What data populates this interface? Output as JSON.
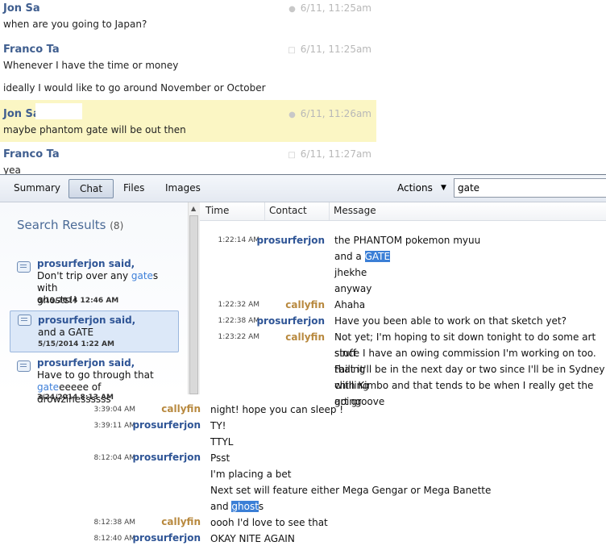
{
  "top_chat": [
    {
      "name": "Jon Sa",
      "meta": "6/11, 11:25am",
      "icon": "pin-icon",
      "lines": [
        "when are you going to Japan?"
      ]
    },
    {
      "name": "Franco Ta",
      "meta": "6/11, 11:25am",
      "icon": "comment-icon",
      "lines": [
        "Whenever I have the time or money",
        "ideally I would like to go around November or October"
      ]
    },
    {
      "name": "Jon Sa",
      "meta": "6/11, 11:26am",
      "icon": "pin-icon",
      "lines": [
        "maybe phantom gate will be out then"
      ]
    },
    {
      "name": "Franco Ta",
      "meta": "6/11, 11:27am",
      "icon": "comment-icon",
      "lines": [
        "yea"
      ]
    }
  ],
  "toolbar": {
    "tabs": [
      "Summary",
      "Chat",
      "Files",
      "Images"
    ],
    "active_tab": "Chat",
    "actions_label": "Actions",
    "search_value": "gate"
  },
  "search_results": {
    "title": "Search Results",
    "count": "(8)",
    "items": [
      {
        "who": "prosurferjon said,",
        "pre1": "Don't trip over any ",
        "hit1": "gate",
        "post1": "s with",
        "line2": "ghosts!!",
        "date": "6/19/2014 12:46 AM"
      },
      {
        "who": "prosurferjon said,",
        "pre1": "and a GATE",
        "hit1": "",
        "post1": "",
        "line2": "",
        "date": "5/15/2014 1:22 AM"
      },
      {
        "who": "prosurferjon said,",
        "pre1": "Have to go through that",
        "hit1": "",
        "post1": "",
        "line2_hit": "gate",
        "line2_post": "eeeee of drowzinessssss",
        "date": "3/24/2014 8:13 AM"
      }
    ]
  },
  "grid": {
    "columns": [
      "Time",
      "Contact",
      "Message"
    ],
    "rows": [
      {
        "time": "1:22:14 AM",
        "contact": "prosurferjon",
        "who": "pro",
        "lines": [
          "the PHANTOM pokemon myuu"
        ]
      },
      {
        "time": "",
        "contact": "",
        "who": "pro",
        "pre": "and a ",
        "hl": "GATE",
        "lines": []
      },
      {
        "time": "",
        "contact": "",
        "who": "pro",
        "lines": [
          "jhekhe"
        ]
      },
      {
        "time": "",
        "contact": "",
        "who": "pro",
        "lines": [
          "anyway"
        ]
      },
      {
        "time": "1:22:32 AM",
        "contact": "callyfin",
        "who": "cal",
        "lines": [
          "Ahaha"
        ]
      },
      {
        "time": "1:22:38 AM",
        "contact": "prosurferjon",
        "who": "pro",
        "lines": [
          "Have you been able to work on that sketch yet?"
        ]
      },
      {
        "time": "1:23:22 AM",
        "contact": "callyfin",
        "who": "cal",
        "lines": [
          "Not yet; I'm hoping to sit down tonight to do some art stuff",
          "since I have an owing commission I'm working on too. Failing",
          "that it'll be in the next day or two since I'll be in Sydney chilling",
          "with Kimbo and that tends to be when I really get the art groove",
          "going"
        ]
      }
    ]
  },
  "bottom_log": [
    {
      "time": "3:39:04 AM",
      "contact": "callyfin",
      "who": "cal",
      "text": "night! hope you can sleep !"
    },
    {
      "time": "3:39:11 AM",
      "contact": "prosurferjon",
      "who": "pro",
      "text": "TY!"
    },
    {
      "time": "",
      "contact": "",
      "who": "pro",
      "text": "TTYL"
    },
    {
      "time": "8:12:04 AM",
      "contact": "prosurferjon",
      "who": "pro",
      "text": "Psst"
    },
    {
      "time": "",
      "contact": "",
      "who": "pro",
      "text": "I'm placing a bet"
    },
    {
      "time": "",
      "contact": "",
      "who": "pro",
      "text": "Next set will feature either Mega Gengar or Mega Banette"
    },
    {
      "time": "",
      "contact": "",
      "who": "pro",
      "pre": "and ",
      "hl": "ghost",
      "post": "s",
      "text": ""
    },
    {
      "time": "8:12:38 AM",
      "contact": "callyfin",
      "who": "cal",
      "text": "oooh I'd love to see that"
    },
    {
      "time": "8:12:40 AM",
      "contact": "prosurferjon",
      "who": "pro",
      "text": "OKAY NITE AGAIN"
    }
  ]
}
